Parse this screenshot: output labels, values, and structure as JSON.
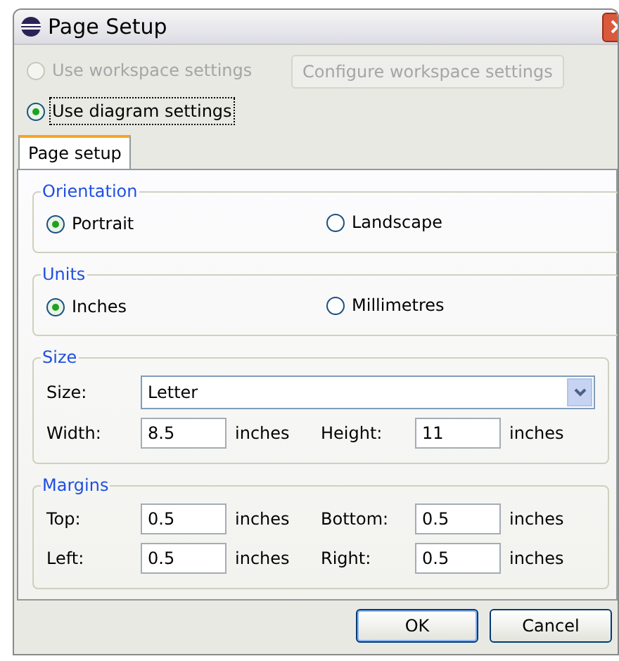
{
  "window": {
    "title": "Page Setup"
  },
  "source": [
    {
      "label": "Use workspace settings",
      "selected": false,
      "disabled": true
    },
    {
      "label": "Use diagram settings",
      "selected": true,
      "disabled": false
    }
  ],
  "configure_button": {
    "label": "Configure workspace settings",
    "disabled": true
  },
  "tabs": [
    {
      "label": "Page setup",
      "selected": true
    }
  ],
  "orientation": {
    "title": "Orientation",
    "options": [
      {
        "label": "Portrait",
        "selected": true
      },
      {
        "label": "Landscape",
        "selected": false
      }
    ]
  },
  "units": {
    "title": "Units",
    "options": [
      {
        "label": "Inches",
        "selected": true
      },
      {
        "label": "Millimetres",
        "selected": false
      }
    ]
  },
  "size": {
    "title": "Size",
    "size_label": "Size:",
    "size_value": "Letter",
    "rows": [
      [
        {
          "label": "Width:",
          "value": "8.5",
          "unit": "inches"
        },
        {
          "label": "Height:",
          "value": "11",
          "unit": "inches"
        }
      ]
    ]
  },
  "margins": {
    "title": "Margins",
    "rows": [
      [
        {
          "label": "Top:",
          "value": "0.5",
          "unit": "inches"
        },
        {
          "label": "Bottom:",
          "value": "0.5",
          "unit": "inches"
        }
      ],
      [
        {
          "label": "Left:",
          "value": "0.5",
          "unit": "inches"
        },
        {
          "label": "Right:",
          "value": "0.5",
          "unit": "inches"
        }
      ]
    ]
  },
  "buttons": [
    {
      "label": "OK",
      "default": true
    },
    {
      "label": "Cancel",
      "default": false
    }
  ]
}
